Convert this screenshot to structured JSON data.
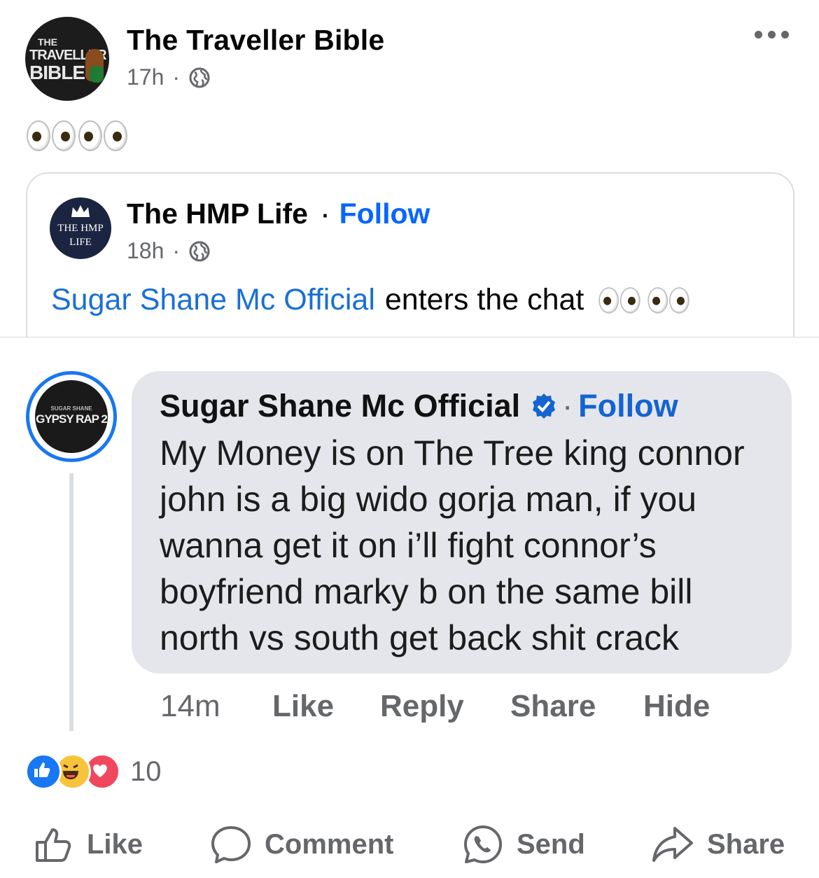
{
  "post": {
    "author": "The Traveller Bible",
    "avatar_text": [
      "THE",
      "TRAVELLER",
      "BIBLE"
    ],
    "time": "17h",
    "audience_icon": "globe-icon",
    "body_emoji": "👀👀"
  },
  "shared": {
    "author": "The HMP Life",
    "follow_label": "Follow",
    "avatar_text": [
      "THE HMP",
      "LIFE"
    ],
    "time": "18h",
    "text_link": "Sugar Shane Mc Official",
    "text_rest": "enters the chat"
  },
  "comment": {
    "author": "Sugar Shane Mc Official",
    "follow_label": "Follow",
    "avatar_small": "SUGAR SHANE",
    "avatar_big": "GYPSY RAP 2",
    "lines": [
      "My Money is on The Tree king connor",
      "john is a big wido gorja man, if you",
      "wanna get it on i’ll fight connor’s",
      "boyfriend marky b on the same bill",
      "north vs south get back shit crack"
    ],
    "time": "14m",
    "actions": {
      "like": "Like",
      "reply": "Reply",
      "share": "Share",
      "hide": "Hide"
    }
  },
  "reactions": {
    "count": "10",
    "types": [
      "like",
      "haha",
      "love"
    ]
  },
  "bottom_bar": {
    "like": "Like",
    "comment": "Comment",
    "send": "Send",
    "share": "Share"
  },
  "colors": {
    "accent": "#0866ff",
    "muted": "#65676b",
    "bubble": "#e5e6eb"
  }
}
